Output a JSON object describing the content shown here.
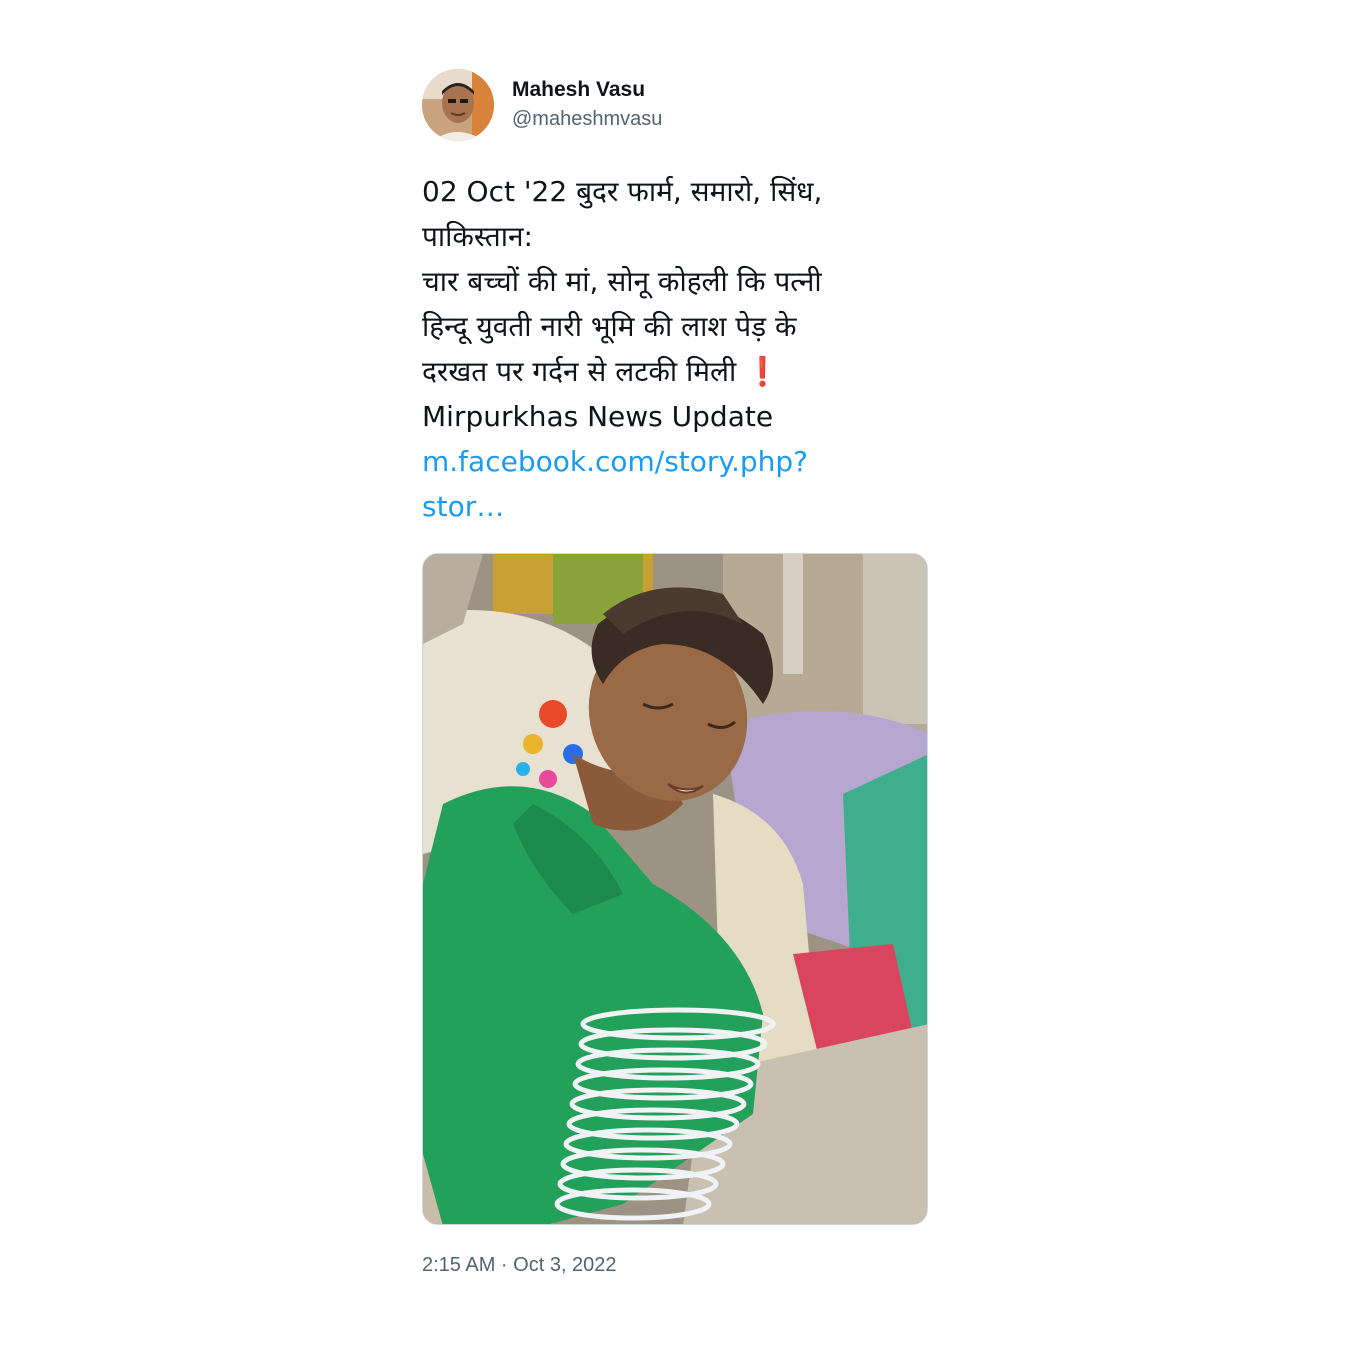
{
  "author": {
    "display_name": "Mahesh Vasu",
    "handle": "@maheshmvasu",
    "avatar_icon": "profile-photo"
  },
  "tweet": {
    "lines": [
      "02 Oct '22 बुदर फार्म, समारो, सिंध,",
      "पाकिस्तान:",
      "चार बच्चों की मां, सोनू कोहली कि पत्नी",
      "हिन्दू युवती नारी भूमि की लाश पेड़ के",
      "दरखत पर गर्दन से लटकी मिली",
      "Mirpurkhas News Update"
    ],
    "exclamation": "❗",
    "link_line_1": "m.facebook.com/story.php?",
    "link_line_2": "stor…",
    "timestamp": "2:15 AM · Oct 3, 2022"
  },
  "media": {
    "type": "photo"
  },
  "colors": {
    "link": "#1d9bf0",
    "secondary_text": "#536471",
    "primary_text": "#0f1419",
    "border": "#cfd9de"
  }
}
